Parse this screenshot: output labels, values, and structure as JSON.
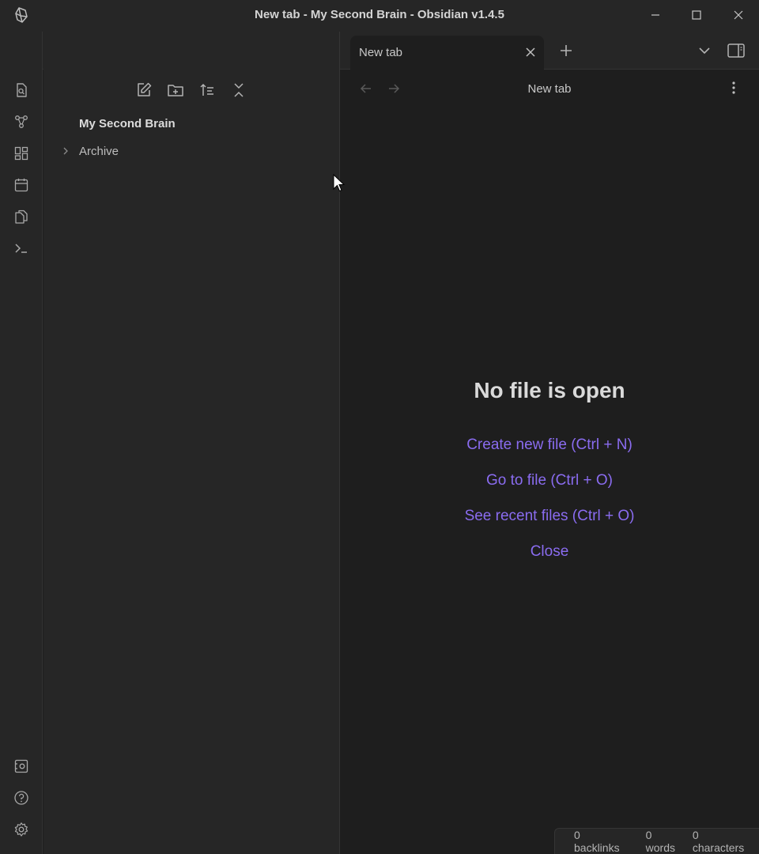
{
  "window": {
    "title": "New tab - My Second Brain - Obsidian v1.4.5",
    "controls": [
      "minimize",
      "maximize",
      "close"
    ]
  },
  "ribbon": {
    "top_icons": [
      "open-quick-switcher-icon",
      "graph-view-icon",
      "canvas-icon",
      "daily-note-icon",
      "templates-icon",
      "command-palette-icon"
    ],
    "bottom_icons": [
      "vault-switcher-icon",
      "help-icon",
      "settings-icon"
    ]
  },
  "sidebar": {
    "tabs": [
      "files-icon",
      "search-icon",
      "bookmarks-icon"
    ],
    "active_tab": "files-icon",
    "actions": [
      "new-note-icon",
      "new-folder-icon",
      "sort-icon",
      "collapse-all-icon"
    ],
    "vault_name": "My Second Brain",
    "folders": [
      {
        "label": "Archive",
        "collapsed": true
      }
    ]
  },
  "tabs": [
    {
      "label": "New tab",
      "active": true
    }
  ],
  "main": {
    "view_title": "New tab",
    "empty_title": "No file is open",
    "actions": [
      {
        "label": "Create new file (Ctrl + N)"
      },
      {
        "label": "Go to file (Ctrl + O)"
      },
      {
        "label": "See recent files (Ctrl + O)"
      },
      {
        "label": "Close"
      }
    ]
  },
  "status": {
    "backlinks": "0 backlinks",
    "words": "0 words",
    "characters": "0 characters"
  },
  "colors": {
    "accent": "#8a6cf0",
    "background": "#1e1e1e",
    "panel": "#262626"
  }
}
